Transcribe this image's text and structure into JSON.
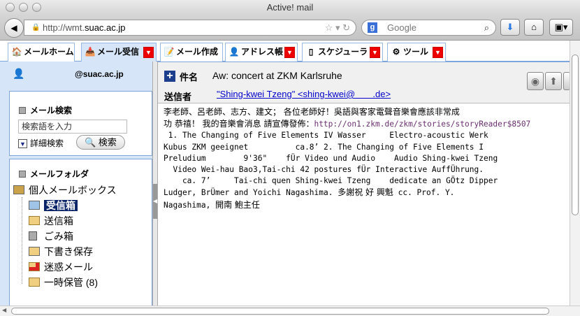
{
  "window": {
    "title": "Active! mail"
  },
  "browser": {
    "url_prefix": "http://wmt.",
    "url_domain": "suac.ac.jp",
    "search_placeholder": "Google"
  },
  "tabs": [
    {
      "label": "メールホーム",
      "icon": "home-icon",
      "dropdown": false
    },
    {
      "label": "メール受信",
      "icon": "inbox-icon",
      "dropdown": true,
      "active": true
    },
    {
      "label": "メール作成",
      "icon": "compose-icon",
      "dropdown": false
    },
    {
      "label": "アドレス帳",
      "icon": "address-book-icon",
      "dropdown": true
    },
    {
      "label": "スケジューラ",
      "icon": "calendar-icon",
      "dropdown": true
    },
    {
      "label": "ツール",
      "icon": "gear-icon",
      "dropdown": true
    }
  ],
  "sidebar": {
    "user": "@suac.ac.jp",
    "search": {
      "title": "メール検索",
      "placeholder": "検索語を入力",
      "advanced": "詳細検索",
      "button": "検索"
    },
    "folders": {
      "title": "メールフォルダ",
      "root": "個人メールボックス",
      "items": [
        {
          "label": "受信箱",
          "selected": true
        },
        {
          "label": "送信箱"
        },
        {
          "label": "ごみ箱"
        },
        {
          "label": "下書き保存"
        },
        {
          "label": "迷惑メール"
        },
        {
          "label": "一時保管 (8)"
        }
      ]
    }
  },
  "message": {
    "subject_label": "件名",
    "subject": "Aw: concert at ZKM Karlsruhe",
    "from_label": "送信者",
    "from": "\"Shing-kwei Tzeng\" <shing-kwei@       .de>",
    "body": {
      "l1": "李老師、呂老師、志方、建文； 各位老師好！吳語與客家電聲音樂會應該非常成",
      "l2a": "功 恭禧！ 我的音樂會消息 請宣傳發佈：",
      "l2link": "http://on1.zkm.de/zkm/stories/storyReader$8507",
      "l3": " 1. The Changing of Five Elements IV Wasser     Electro-acoustic Werk",
      "l4": "Kubus ZKM geeignet          ca.8’ 2. The Changing of Five Elements I",
      "l5": "Preludium        9'36\"    fÜr Video und Audio    Audio Shing-kwei Tzeng",
      "l6": "  Video Wei-hau Bao3,Tai-chi 42 postures fÜr Interactive AuffÜhrung.",
      "l7": "    ca. 7’     Tai-chi quen Shing-kwei Tzeng    dedicate an GÖtz Dipper",
      "l8a": "Ludger, BrÜmer and Yoichi Nagashima. ",
      "l8b": "多謝祝 好 興魁",
      "l8c": " cc. Prof. Y.",
      "l9a": "Nagashima, ",
      "l9b": "開南 鮑主任"
    }
  }
}
